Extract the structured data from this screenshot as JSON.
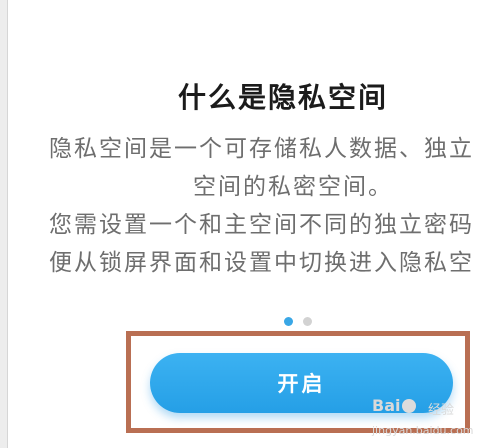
{
  "page": {
    "title": "什么是隐私空间",
    "description_lines": [
      "隐私空间是一个可存储私人数据、独立",
      "空间的私密空间。",
      "您需设置一个和主空间不同的独立密码",
      "便从锁屏界面和设置中切换进入隐私空"
    ]
  },
  "pager": {
    "total": 2,
    "active_index": 0
  },
  "actions": {
    "start_label": "开启"
  },
  "watermark": {
    "logo_text": "Baidu",
    "label": "经验",
    "url": "jingyan.baidu.com"
  },
  "colors": {
    "accent": "#2aa4eb",
    "highlight_border": "#b96f53",
    "title": "#1b1b1b",
    "body_text": "#6e6e6e"
  }
}
